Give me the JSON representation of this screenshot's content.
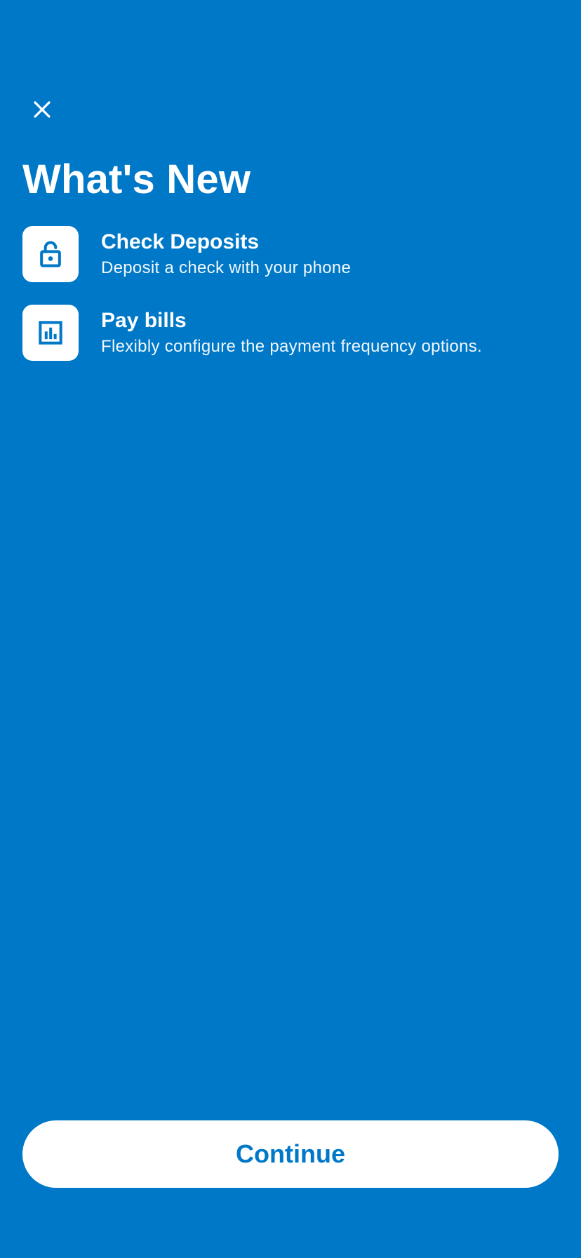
{
  "colors": {
    "background": "#0078C8",
    "accent": "#0078C8",
    "text": "#FFFFFF",
    "button_bg": "#FFFFFF"
  },
  "header": {
    "close_icon": "close-icon"
  },
  "page": {
    "title": "What's New"
  },
  "features": [
    {
      "icon": "unlock-icon",
      "title": "Check Deposits",
      "description": "Deposit a check with your phone"
    },
    {
      "icon": "bar-chart-icon",
      "title": "Pay bills",
      "description": "Flexibly configure the payment frequency options."
    }
  ],
  "footer": {
    "continue_label": "Continue"
  }
}
